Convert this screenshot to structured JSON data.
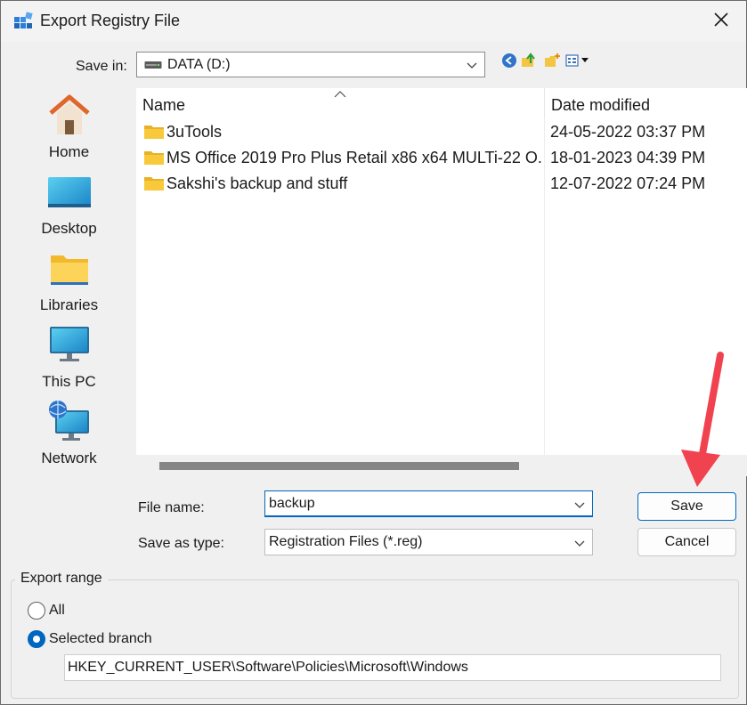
{
  "window": {
    "title": "Export Registry File",
    "icon": "registry-editor-icon",
    "close_icon": "close-icon"
  },
  "save_in": {
    "label": "Save in:",
    "value": "DATA (D:)",
    "icon": "drive-icon"
  },
  "toolbar_icons": [
    "back-icon",
    "up-folder-icon",
    "new-folder-icon",
    "view-menu-icon"
  ],
  "places": [
    {
      "label": "Home",
      "icon": "home-icon"
    },
    {
      "label": "Desktop",
      "icon": "desktop-icon"
    },
    {
      "label": "Libraries",
      "icon": "libraries-icon"
    },
    {
      "label": "This PC",
      "icon": "this-pc-icon"
    },
    {
      "label": "Network",
      "icon": "network-icon"
    }
  ],
  "file_list": {
    "columns": [
      "Name",
      "Date modified"
    ],
    "rows": [
      {
        "name": "3uTools",
        "date": "24-05-2022 03:37 PM",
        "icon": "folder-icon"
      },
      {
        "name": "MS Office 2019 Pro Plus Retail x86 x64  MULTi-22 O...",
        "date": "18-01-2023 04:39 PM",
        "icon": "folder-icon"
      },
      {
        "name": "Sakshi's backup and stuff",
        "date": "12-07-2022 07:24 PM",
        "icon": "folder-icon"
      }
    ]
  },
  "file_name": {
    "label": "File name:",
    "value": "backup"
  },
  "save_as_type": {
    "label": "Save as type:",
    "value": "Registration Files (*.reg)"
  },
  "buttons": {
    "save": "Save",
    "cancel": "Cancel"
  },
  "export_range": {
    "label": "Export range",
    "options": [
      {
        "label": "All",
        "selected": false
      },
      {
        "label": "Selected branch",
        "selected": true
      }
    ],
    "branch_path": "HKEY_CURRENT_USER\\Software\\Policies\\Microsoft\\Windows"
  },
  "colors": {
    "accent": "#0067c0",
    "annotation_arrow": "#f0424f",
    "folder": "#f8c93b"
  }
}
